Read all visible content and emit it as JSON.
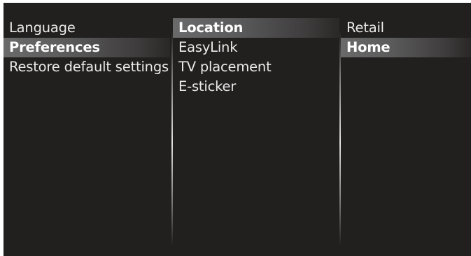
{
  "menu": {
    "column1": {
      "items": [
        "Language",
        "Preferences",
        "Restore default settings"
      ],
      "selected_index": 1
    },
    "column2": {
      "items": [
        "Location",
        "EasyLink",
        "TV placement",
        "E-sticker"
      ],
      "selected_index": 0
    },
    "column3": {
      "items": [
        "Retail",
        "Home"
      ],
      "selected_index": 1
    }
  },
  "colors": {
    "background": "#221f1f",
    "text": "#e9e9e9",
    "highlight": "#6a6a6a"
  }
}
